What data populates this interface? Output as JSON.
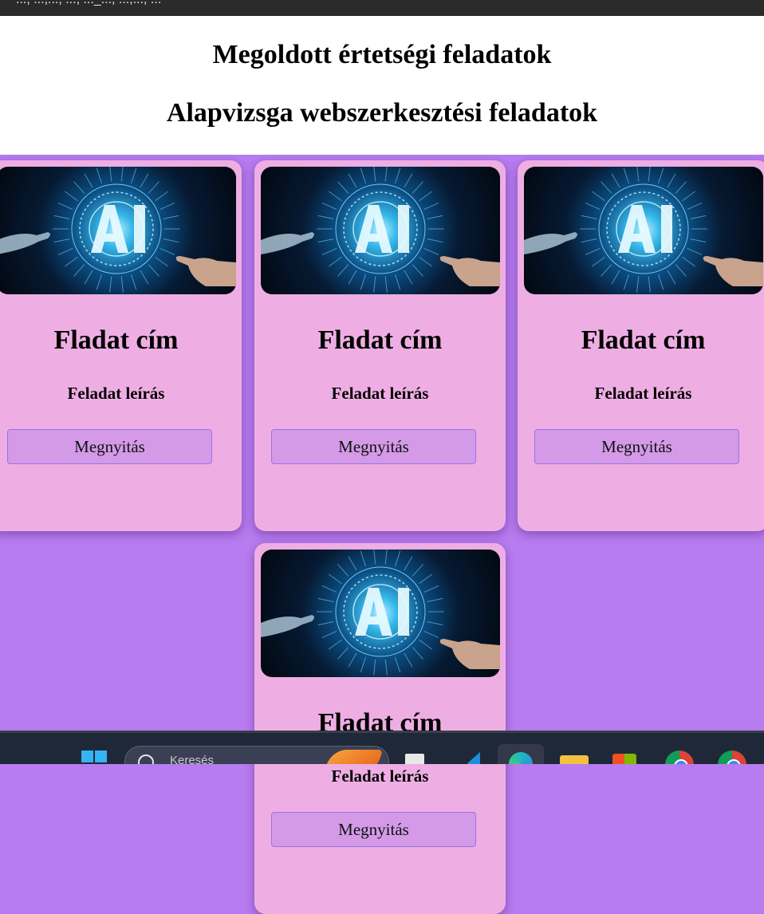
{
  "browser": {
    "address_fragment": "..., ...,..., ..., ..._..., ...,..., ..."
  },
  "page": {
    "title": "Megoldott értetségi feladatok",
    "subtitle": "Alapvizsga webszerkesztési feladatok"
  },
  "cards": [
    {
      "image": "ai-hand-image",
      "title": "Fladat cím",
      "description": "Feladat leírás",
      "button": "Megnyitás"
    },
    {
      "image": "ai-hand-image",
      "title": "Fladat cím",
      "description": "Feladat leírás",
      "button": "Megnyitás"
    },
    {
      "image": "ai-hand-image",
      "title": "Fladat cím",
      "description": "Feladat leírás",
      "button": "Megnyitás"
    },
    {
      "image": "ai-hand-image",
      "title": "Fladat cím",
      "description": "Feladat leírás",
      "button": "Megnyitás"
    }
  ],
  "taskbar": {
    "search_placeholder": "Keresés",
    "items": [
      "windows-start-icon",
      "search-icon",
      "task-view-icon",
      "vscode-icon",
      "edge-icon",
      "file-explorer-icon",
      "microsoft-store-icon",
      "chrome-icon",
      "chrome-icon"
    ]
  },
  "colors": {
    "page_background": "#b77cf0",
    "card_background": "#eeaee3",
    "button_background": "#d49ae8",
    "button_border": "#9a72e8",
    "header_background": "#ffffff"
  }
}
